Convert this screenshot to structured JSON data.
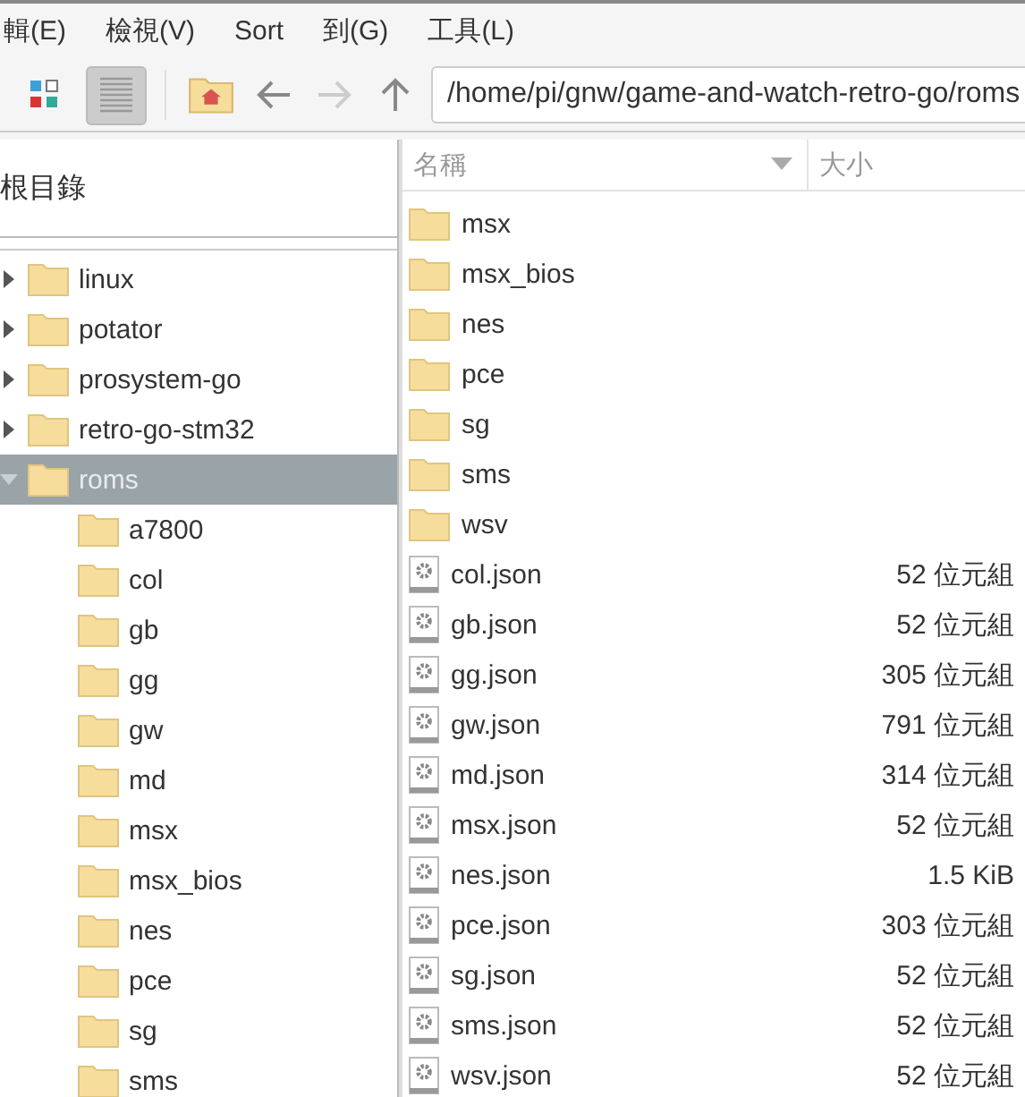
{
  "menu": [
    "輯(E)",
    "檢視(V)",
    "Sort",
    "到(G)",
    "工具(L)"
  ],
  "toolbar": {
    "icon_view_selected": false,
    "list_view_selected": true,
    "back_disabled": false,
    "forward_disabled": true,
    "path": "/home/pi/gnw/game-and-watch-retro-go/roms"
  },
  "sidebar": {
    "title": "根目錄",
    "tree": [
      {
        "label": "linux",
        "expanded": false,
        "selected": false
      },
      {
        "label": "potator",
        "expanded": false,
        "selected": false
      },
      {
        "label": "prosystem-go",
        "expanded": false,
        "selected": false
      },
      {
        "label": "retro-go-stm32",
        "expanded": false,
        "selected": false
      },
      {
        "label": "roms",
        "expanded": true,
        "selected": true,
        "children": [
          {
            "label": "a7800",
            "selected": false
          },
          {
            "label": "col",
            "selected": false
          },
          {
            "label": "gb",
            "selected": false
          },
          {
            "label": "gg",
            "selected": false
          },
          {
            "label": "gw",
            "selected": false
          },
          {
            "label": "md",
            "selected": false
          },
          {
            "label": "msx",
            "selected": false
          },
          {
            "label": "msx_bios",
            "selected": false
          },
          {
            "label": "nes",
            "selected": false
          },
          {
            "label": "pce",
            "selected": false
          },
          {
            "label": "sg",
            "selected": false
          },
          {
            "label": "sms",
            "selected": false
          }
        ]
      }
    ]
  },
  "file_list": {
    "columns": [
      "名稱",
      "大小"
    ],
    "rows": [
      {
        "kind": "folder",
        "name": "msx"
      },
      {
        "kind": "folder",
        "name": "msx_bios"
      },
      {
        "kind": "folder",
        "name": "nes"
      },
      {
        "kind": "folder",
        "name": "pce"
      },
      {
        "kind": "folder",
        "name": "sg"
      },
      {
        "kind": "folder",
        "name": "sms"
      },
      {
        "kind": "folder",
        "name": "wsv"
      },
      {
        "kind": "file",
        "name": "col.json",
        "size": "52 位元組"
      },
      {
        "kind": "file",
        "name": "gb.json",
        "size": "52 位元組"
      },
      {
        "kind": "file",
        "name": "gg.json",
        "size": "305 位元組"
      },
      {
        "kind": "file",
        "name": "gw.json",
        "size": "791 位元組"
      },
      {
        "kind": "file",
        "name": "md.json",
        "size": "314 位元組"
      },
      {
        "kind": "file",
        "name": "msx.json",
        "size": "52 位元組"
      },
      {
        "kind": "file",
        "name": "nes.json",
        "size": "1.5 KiB"
      },
      {
        "kind": "file",
        "name": "pce.json",
        "size": "303 位元組"
      },
      {
        "kind": "file",
        "name": "sg.json",
        "size": "52 位元組"
      },
      {
        "kind": "file",
        "name": "sms.json",
        "size": "52 位元組"
      },
      {
        "kind": "file",
        "name": "wsv.json",
        "size": "52 位元組"
      }
    ]
  }
}
